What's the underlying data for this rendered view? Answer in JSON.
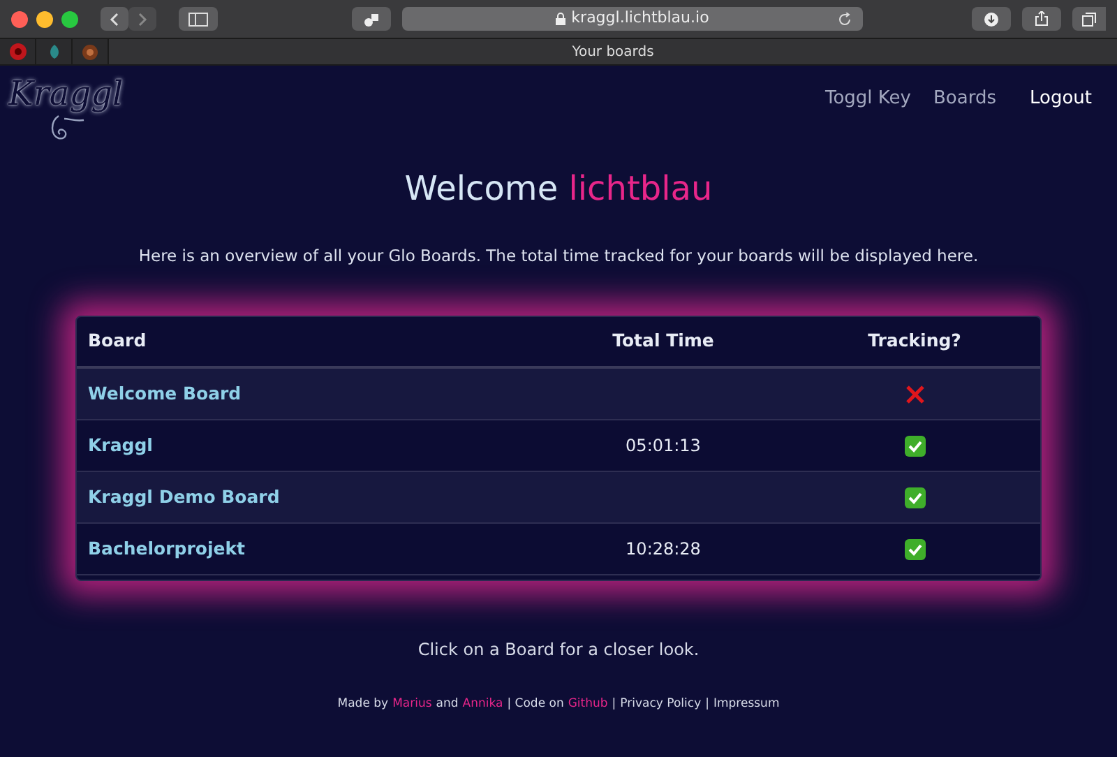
{
  "browser": {
    "url": "kraggl.lichtblau.io",
    "tab_title": "Your boards"
  },
  "logo": "Kraggl",
  "nav": [
    {
      "label": "Toggl Key",
      "active": false
    },
    {
      "label": "Boards",
      "active": false
    },
    {
      "label": "Logout",
      "active": true
    }
  ],
  "heading": {
    "greeting": "Welcome",
    "user": "lichtblau"
  },
  "intro": "Here is an overview of all your Glo Boards. The total time tracked for your boards will be displayed here.",
  "table": {
    "columns": [
      "Board",
      "Total Time",
      "Tracking?"
    ],
    "rows": [
      {
        "board": "Welcome Board",
        "total_time": "",
        "tracking": false
      },
      {
        "board": "Kraggl",
        "total_time": "05:01:13",
        "tracking": true
      },
      {
        "board": "Kraggl Demo Board",
        "total_time": "",
        "tracking": true
      },
      {
        "board": "Bachelorprojekt",
        "total_time": "10:28:28",
        "tracking": true
      }
    ]
  },
  "hint": "Click on a Board for a closer look.",
  "footer": [
    {
      "kind": "text",
      "text": "Made by"
    },
    {
      "kind": "highlight",
      "text": "Marius"
    },
    {
      "kind": "text",
      "text": "and"
    },
    {
      "kind": "highlight",
      "text": "Annika"
    },
    {
      "kind": "text",
      "text": "| Code on"
    },
    {
      "kind": "highlight",
      "text": "Github"
    },
    {
      "kind": "text",
      "text": "|"
    },
    {
      "kind": "link",
      "text": "Privacy Policy"
    },
    {
      "kind": "text",
      "text": "|"
    },
    {
      "kind": "link",
      "text": "Impressum"
    }
  ]
}
